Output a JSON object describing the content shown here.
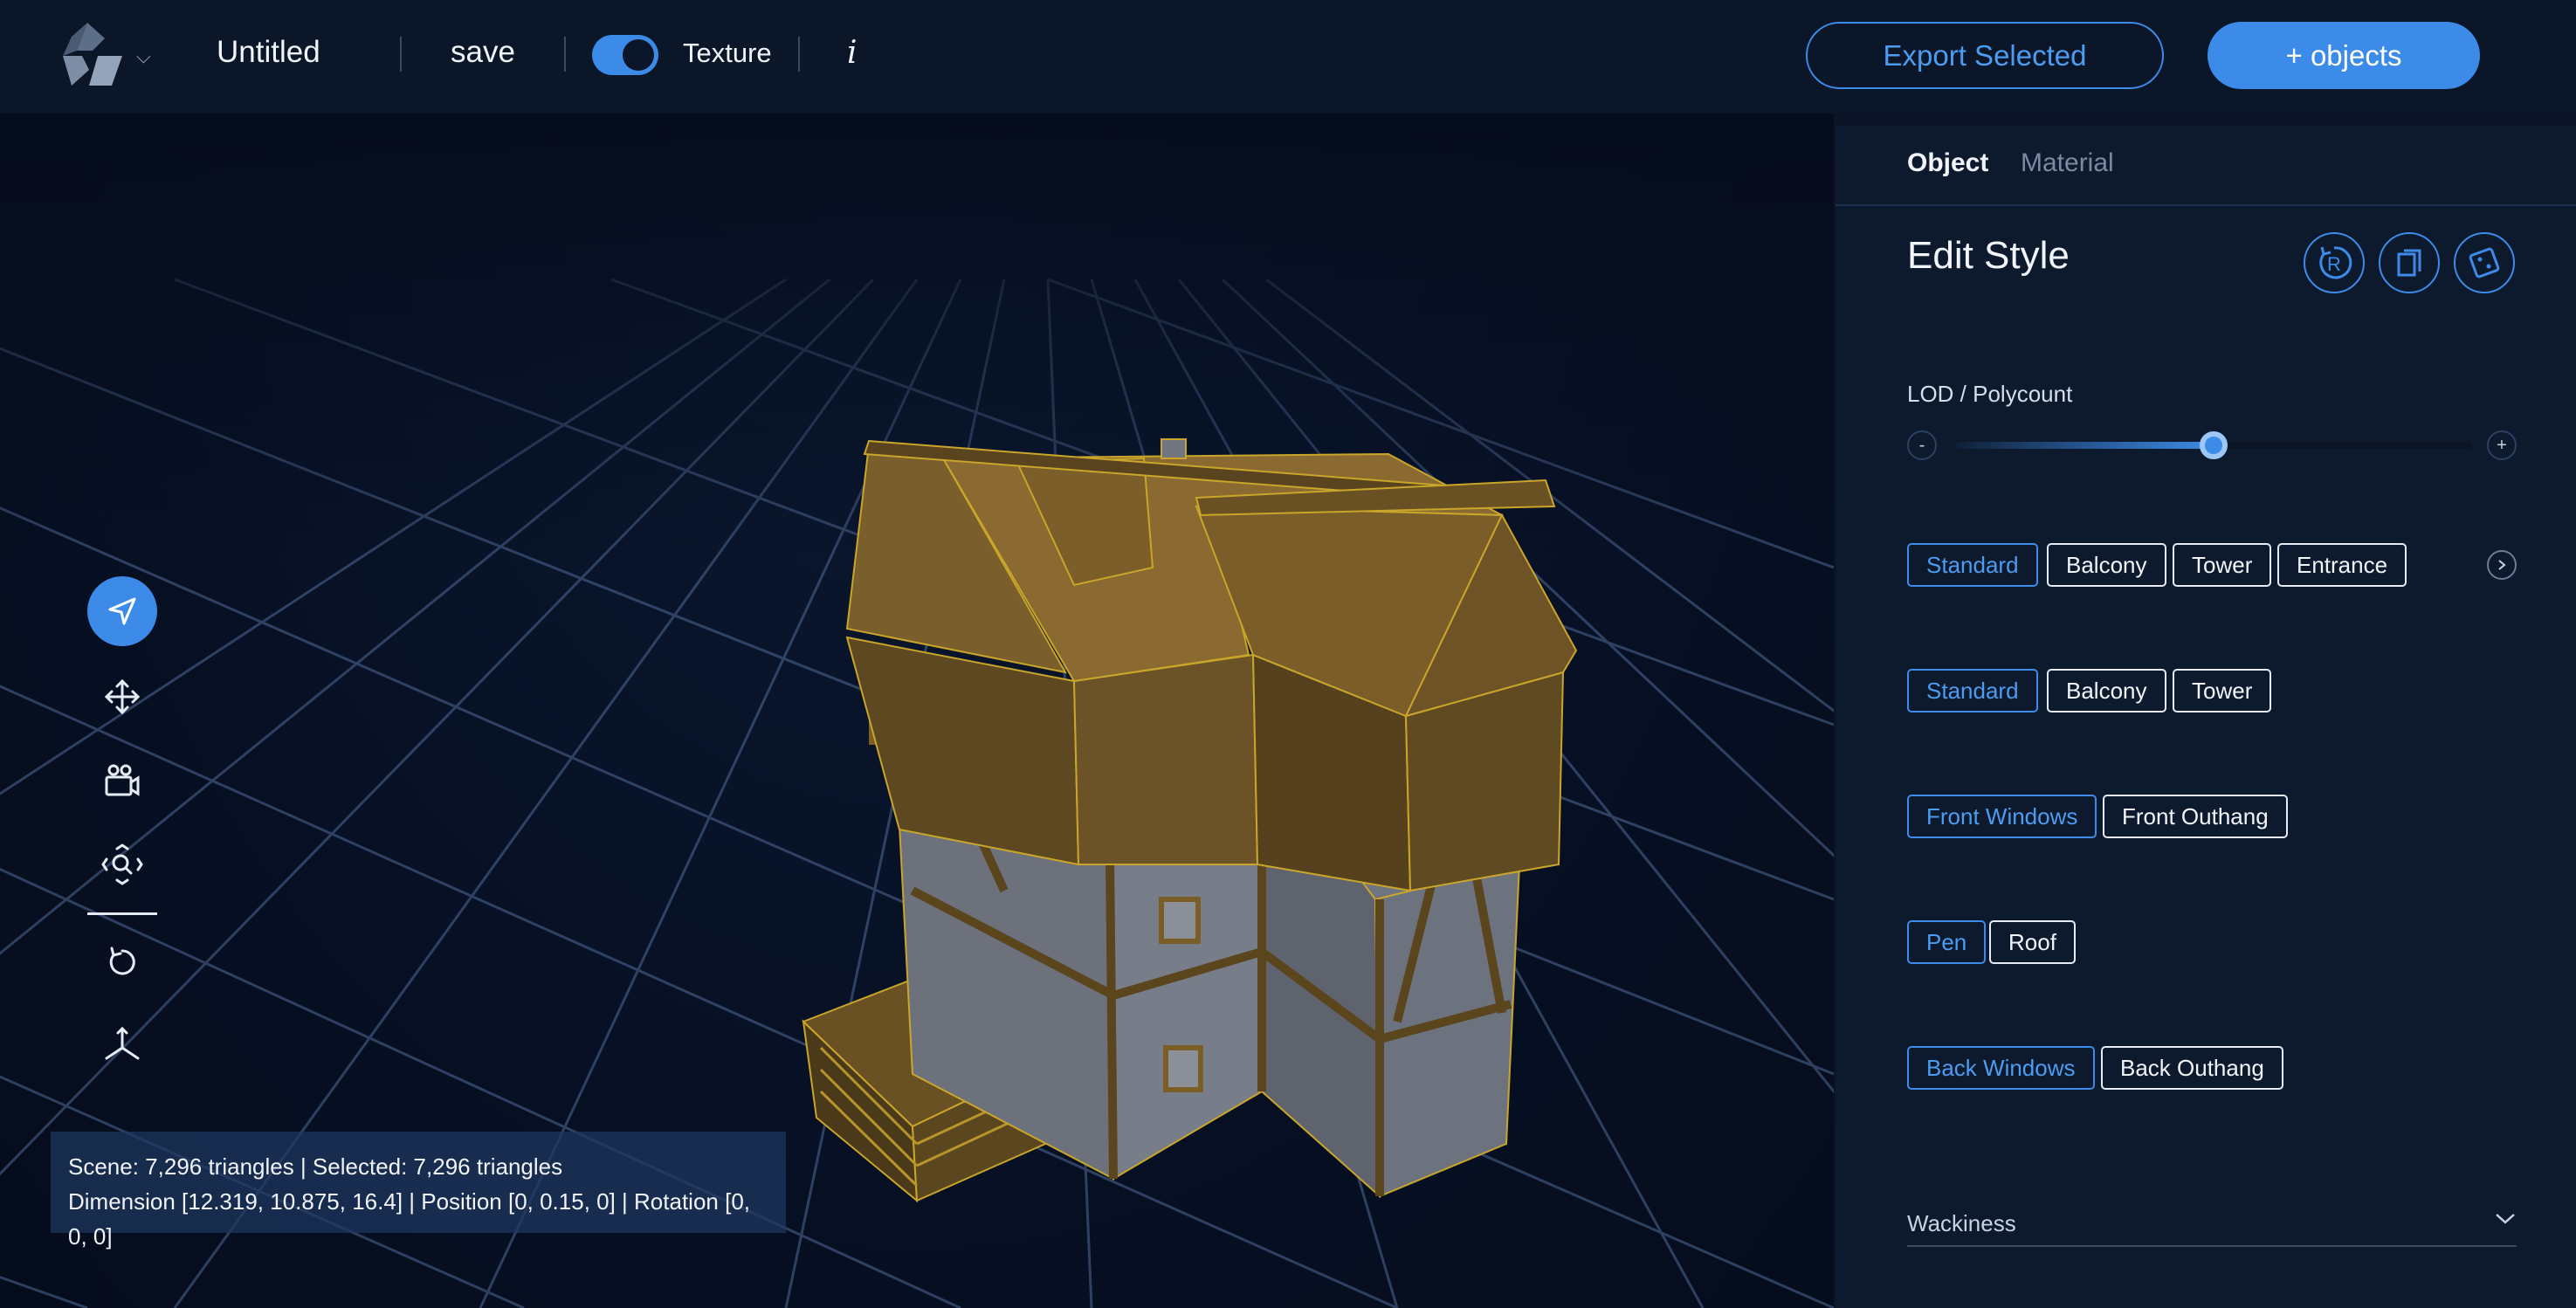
{
  "header": {
    "title": "Untitled",
    "save_label": "save",
    "texture_label": "Texture",
    "texture_on": true,
    "info_label": "i",
    "export_label": "Export Selected",
    "add_objects_label": "+ objects"
  },
  "toolbar": {
    "tools": [
      {
        "name": "select-icon",
        "active": true
      },
      {
        "name": "move-icon",
        "active": false
      },
      {
        "name": "camera-icon",
        "active": false
      },
      {
        "name": "zoom-icon",
        "active": false
      },
      {
        "name": "rotate-icon",
        "active": false
      },
      {
        "name": "axes-icon",
        "active": false
      }
    ]
  },
  "stats": {
    "line1": "Scene: 7,296 triangles | Selected: 7,296 triangles",
    "line2": "Dimension [12.319, 10.875, 16.4] | Position [0, 0.15, 0] | Rotation [0, 0, 0]"
  },
  "panel": {
    "tabs": [
      {
        "label": "Object",
        "active": true
      },
      {
        "label": "Material",
        "active": false
      }
    ],
    "title": "Edit Style",
    "action_icons": [
      "reset-icon",
      "duplicate-icon",
      "randomize-icon"
    ],
    "lod": {
      "label": "LOD / Polycount",
      "minus": "-",
      "plus": "+",
      "value_fraction": 0.5
    },
    "option_rows": [
      {
        "options": [
          "Standard",
          "Balcony",
          "Tower",
          "Entrance"
        ],
        "selected": 0,
        "has_next": true
      },
      {
        "options": [
          "Standard",
          "Balcony",
          "Tower"
        ],
        "selected": 0,
        "has_next": false
      },
      {
        "options": [
          "Front Windows",
          "Front Outhang"
        ],
        "selected": 0,
        "has_next": false
      },
      {
        "options": [
          "Pen",
          "Roof"
        ],
        "selected": 0,
        "has_next": false
      },
      {
        "options": [
          "Back Windows",
          "Back Outhang"
        ],
        "selected": 0,
        "has_next": false
      }
    ],
    "wackiness_label": "Wackiness"
  },
  "colors": {
    "accent": "#3d8be8",
    "background": "#0a1426",
    "panel": "#0d1a2e",
    "house_wood": "#6b5327",
    "house_wall": "#6e7480"
  }
}
